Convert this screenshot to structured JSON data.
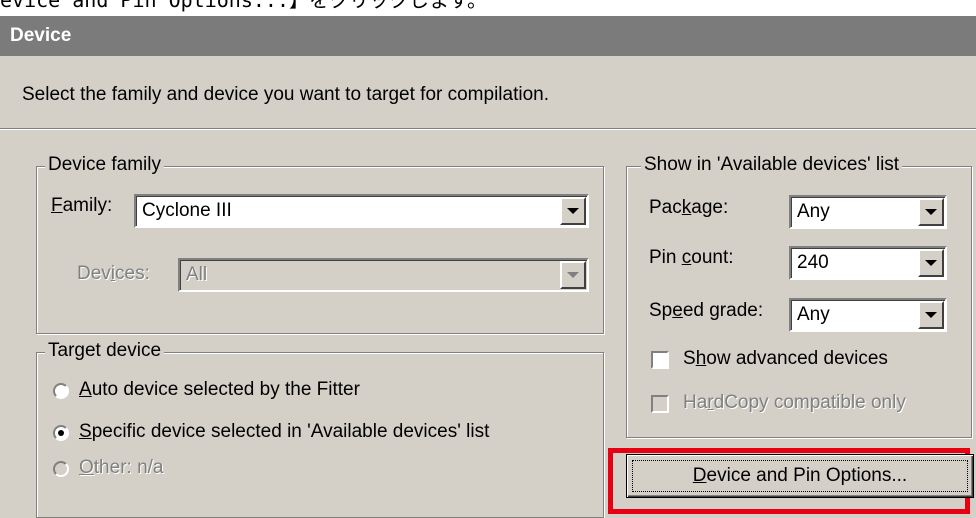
{
  "caption": "evice and Pin Options...】をクリックします。",
  "title": "Device",
  "intro": "Select the family and device you want to target for compilation.",
  "device_family": {
    "legend": "Device family",
    "family_label_u": "F",
    "family_label_rest": "amily:",
    "family_value": "Cyclone III",
    "devices_label_a": "Dev",
    "devices_label_u": "i",
    "devices_label_b": "ces:",
    "devices_value": "All"
  },
  "target_device": {
    "legend": "Target device",
    "options": [
      {
        "u": "A",
        "rest": "uto device selected by the Fitter",
        "selected": false,
        "enabled": true
      },
      {
        "u": "S",
        "rest": "pecific device selected in 'Available devices' list",
        "selected": true,
        "enabled": true
      },
      {
        "u": "O",
        "rest": "ther:  n/a",
        "selected": false,
        "enabled": false
      }
    ]
  },
  "show_list": {
    "legend": "Show in 'Available devices' list",
    "package_a": "Pac",
    "package_u": "k",
    "package_b": "age:",
    "package_value": "Any",
    "pin_a": "Pin ",
    "pin_u": "c",
    "pin_b": "ount:",
    "pin_value": "240",
    "speed_a": "Sp",
    "speed_u": "e",
    "speed_b": "ed grade:",
    "speed_value": "Any",
    "adv_u": "h",
    "adv_a": "S",
    "adv_b": "ow advanced devices",
    "adv_checked": false,
    "hc_a": "Ha",
    "hc_u": "r",
    "hc_b": "dCopy compatible only",
    "hc_checked": false
  },
  "button": {
    "a": "",
    "u": "D",
    "b": "evice and Pin Options..."
  },
  "colors": {
    "dialog_bg": "#d4d0c8",
    "title_bg": "#7b7b7b",
    "highlight": "#e60012"
  }
}
